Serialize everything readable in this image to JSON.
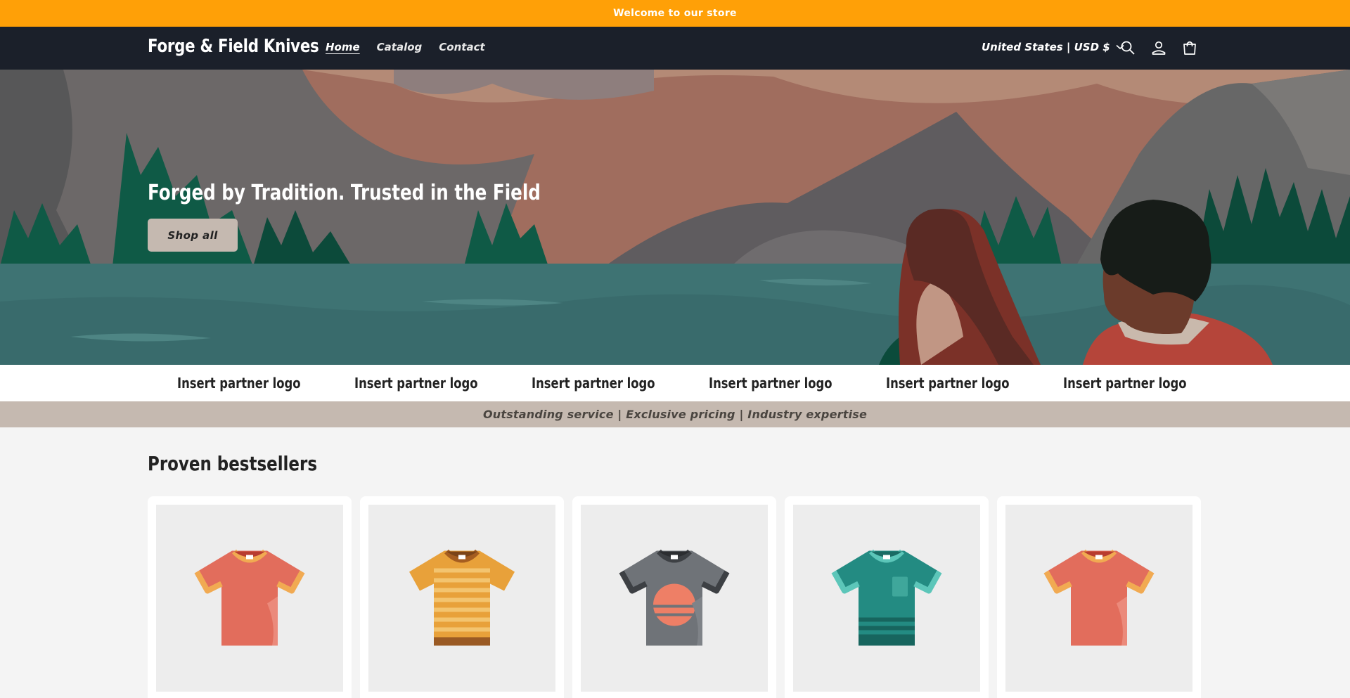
{
  "announcement": {
    "text": "Welcome to our store"
  },
  "header": {
    "store_name": "Forge & Field Knives",
    "nav": [
      {
        "label": "Home",
        "active": true
      },
      {
        "label": "Catalog",
        "active": false
      },
      {
        "label": "Contact",
        "active": false
      }
    ],
    "country_selector": "United States | USD $",
    "icons": [
      "search-icon",
      "account-icon",
      "cart-icon"
    ]
  },
  "hero": {
    "heading": "Forged by Tradition. Trusted in the Field",
    "button_label": "Shop all"
  },
  "partners": {
    "logos": [
      "Insert partner logo",
      "Insert partner logo",
      "Insert partner logo",
      "Insert partner logo",
      "Insert partner logo",
      "Insert partner logo"
    ]
  },
  "tagline": {
    "text": "Outstanding service | Exclusive pricing | Industry expertise"
  },
  "bestsellers": {
    "title": "Proven bestsellers",
    "products": [
      {
        "image": "coral-tshirt",
        "color": "#e26d5c"
      },
      {
        "image": "striped-orange-tshirt",
        "color": "#e8a13a"
      },
      {
        "image": "gray-sunset-tshirt",
        "color": "#6f7378"
      },
      {
        "image": "teal-pocket-tshirt",
        "color": "#238b82"
      },
      {
        "image": "coral-tshirt",
        "color": "#e26d5c"
      }
    ]
  },
  "colors": {
    "announcement_bg": "#ffa007",
    "header_bg": "#1b202a",
    "accent_beige": "#c5b9b0"
  }
}
